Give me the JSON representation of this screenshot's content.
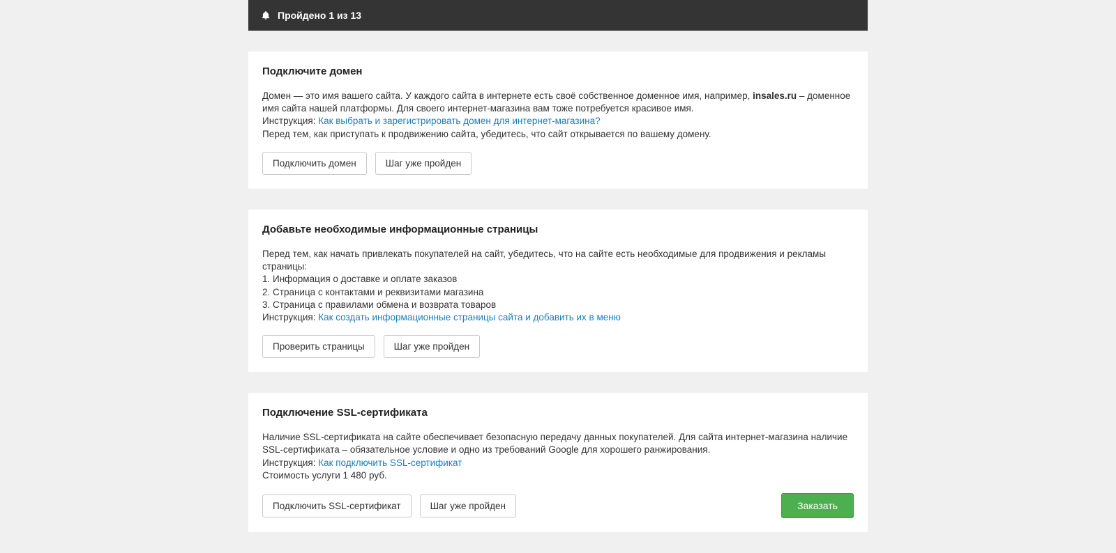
{
  "header": {
    "progress_text": "Пройдено 1 из 13"
  },
  "card1": {
    "title": "Подключите домен",
    "desc_pre": "Домен — это имя вашего сайта. У каждого сайта в интернете есть своё собственное доменное имя, например, ",
    "desc_bold": "insales.ru",
    "desc_post": " – доменное имя сайта нашей платформы. Для своего интернет-магазина вам тоже потребуется красивое имя.",
    "instruction_label": "Инструкция: ",
    "instruction_link": "Как выбрать и зарегистрировать домен для интернет-магазина?",
    "note": "Перед тем, как приступать к продвижению сайта, убедитесь, что сайт открывается по вашему домену.",
    "btn_primary": "Подключить домен",
    "btn_done": "Шаг уже пройден"
  },
  "card2": {
    "title": "Добавьте необходимые информационные страницы",
    "intro": "Перед тем, как начать привлекать покупателей на сайт, убедитесь, что на сайте есть необходимые для продвижения и рекламы страницы:",
    "item1": "1. Информация о доставке и оплате заказов",
    "item2": "2. Страница с контактами и реквизитами магазина",
    "item3": "3. Страница с правилами обмена и возврата товаров",
    "instruction_label": "Инструкция: ",
    "instruction_link": "Как создать информационные страницы сайта и добавить их в меню",
    "btn_primary": "Проверить страницы",
    "btn_done": "Шаг уже пройден"
  },
  "card3": {
    "title": "Подключение SSL-сертификата",
    "desc": "Наличие SSL-сертификата на сайте обеспечивает безопасную передачу данных покупателей. Для сайта интернет-магазина наличие SSL-сертификата – обязательное условие и одно из требований Google для хорошего ранжирования.",
    "instruction_label": "Инструкция: ",
    "instruction_link": "Как подключить SSL-сертификат",
    "cost": "Стоимость услуги 1 480 руб.",
    "btn_primary": "Подключить SSL-сертификат",
    "btn_done": "Шаг уже пройден",
    "btn_order": "Заказать"
  }
}
